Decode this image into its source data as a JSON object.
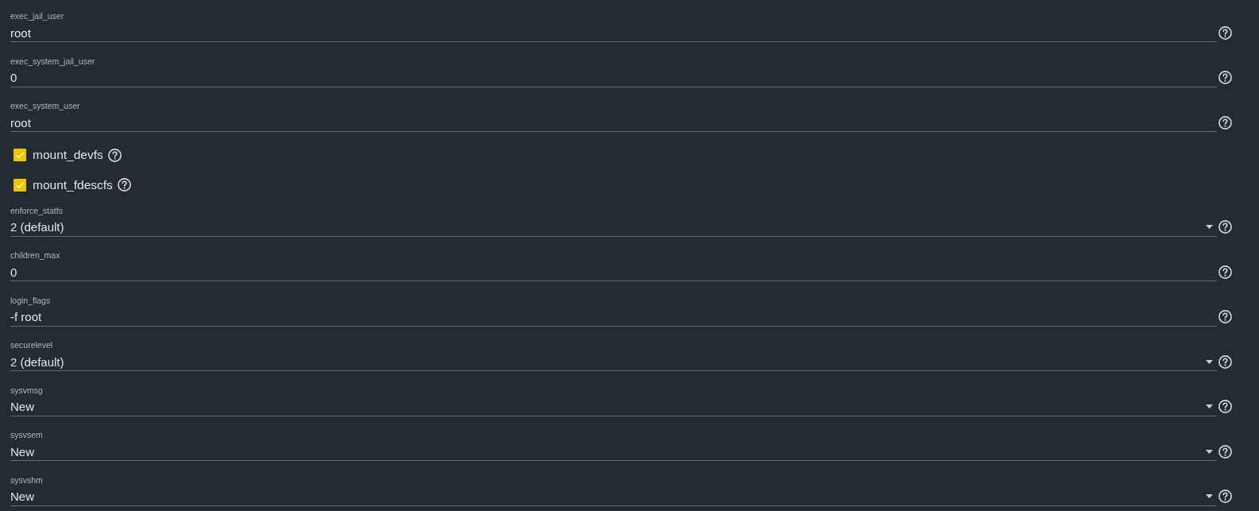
{
  "fields": [
    {
      "kind": "text",
      "label": "exec_jail_user",
      "value": "root"
    },
    {
      "kind": "text",
      "label": "exec_system_jail_user",
      "value": "0"
    },
    {
      "kind": "text",
      "label": "exec_system_user",
      "value": "root"
    },
    {
      "kind": "checkbox",
      "label": "mount_devfs",
      "checked": true
    },
    {
      "kind": "checkbox",
      "label": "mount_fdescfs",
      "checked": true
    },
    {
      "kind": "select",
      "label": "enforce_statfs",
      "value": "2 (default)"
    },
    {
      "kind": "text",
      "label": "children_max",
      "value": "0"
    },
    {
      "kind": "text",
      "label": "login_flags",
      "value": "-f root"
    },
    {
      "kind": "select",
      "label": "securelevel",
      "value": "2 (default)"
    },
    {
      "kind": "select",
      "label": "sysvmsg",
      "value": "New"
    },
    {
      "kind": "select",
      "label": "sysvsem",
      "value": "New"
    },
    {
      "kind": "select",
      "label": "sysvshm",
      "value": "New"
    }
  ]
}
